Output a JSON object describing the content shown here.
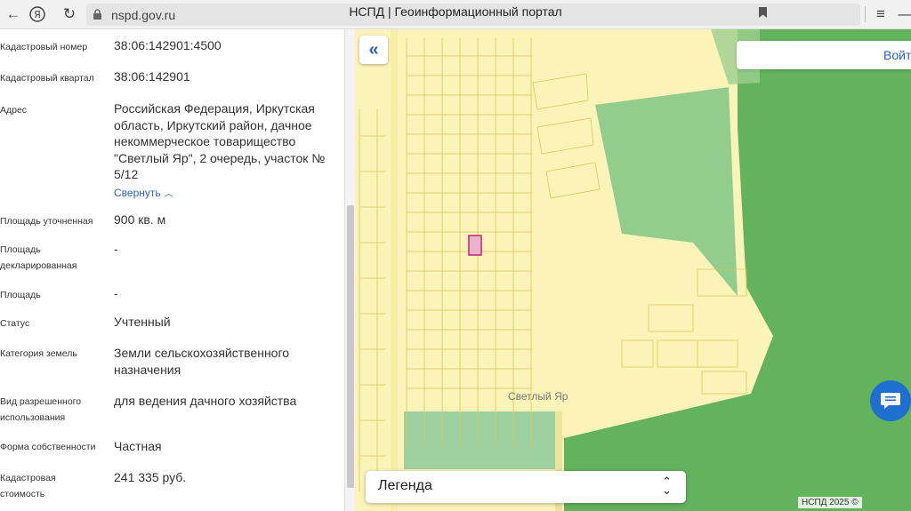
{
  "browser": {
    "url": "nspd.gov.ru",
    "title": "НСПД | Геоинформационный портал"
  },
  "panel": {
    "rows": [
      {
        "label": "Кадастровый номер",
        "value": "38:06:142901:4500"
      },
      {
        "label": "Кадастровый квартал",
        "value": "38:06:142901"
      },
      {
        "label": "Адрес",
        "value": "Российская Федерация, Иркутская область, Иркутский район, дачное некоммерческое товарищество \"Светлый Яр\", 2 очередь, участок № 5/12"
      },
      {
        "label": "Площадь уточненная",
        "value": "900 кв. м"
      },
      {
        "label": "Площадь декларированная",
        "value": "-"
      },
      {
        "label": "Площадь",
        "value": "-"
      },
      {
        "label": "Статус",
        "value": "Учтенный"
      },
      {
        "label": "Категория земель",
        "value": "Земли сельскохозяйственного назначения"
      },
      {
        "label": "Вид разрешенного использования",
        "value": "для ведения дачного хозяйства"
      },
      {
        "label": "Форма собственности",
        "value": "Частная"
      },
      {
        "label": "Кадастровая стоимость",
        "value": "241 335 руб."
      }
    ],
    "collapse_label": "Свернуть"
  },
  "map": {
    "login_label": "Войт",
    "legend_label": "Легенда",
    "place_name": "Светлый Яр",
    "copyright": "НСПД 2025 ©",
    "colors": {
      "settlement": "#fbf3b8",
      "forest": "#62b35c",
      "selected_parcel": "#c0287e",
      "accent": "#2a62c9"
    }
  }
}
